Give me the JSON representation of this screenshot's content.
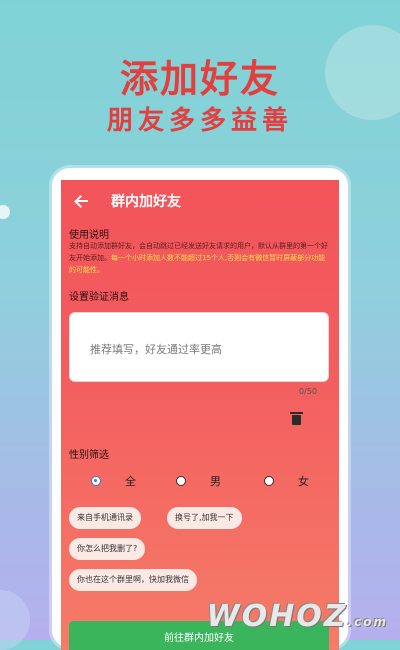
{
  "promo": {
    "headline": "添加好友",
    "subheadline": "朋友多多益善"
  },
  "app": {
    "title": "群内加好友",
    "instructions": {
      "heading": "使用说明",
      "text_normal": "支持自动添加群好友，会自动跳过已经发送好友请求的用户，默认从群里的第一个好友开始添加。",
      "text_highlight": "每一个小时添加人数不能超过15个人,否则会有微信暂时屏蔽部分功能的可能性。"
    },
    "verification": {
      "heading": "设置验证消息",
      "placeholder": "推荐填写，好友通过率更高",
      "counter": "0/50"
    },
    "gender_filter": {
      "heading": "性别筛选",
      "options": [
        "全",
        "男",
        "女"
      ],
      "selected": "全"
    },
    "quick_messages": [
      "来自手机通讯录",
      "换号了,加我一下",
      "你怎么把我删了?",
      "你也在这个群里啊，快加我微信"
    ],
    "primary_button": "前往群内加好友"
  },
  "watermark": {
    "text": "WOHOZ",
    "suffix": ".com"
  },
  "colors": {
    "headline": "#e2403f",
    "app_header": "#f2545a",
    "highlight_text": "#f7e04a",
    "button": "#3bb55c",
    "radio_selected": "#3a7bd5"
  }
}
